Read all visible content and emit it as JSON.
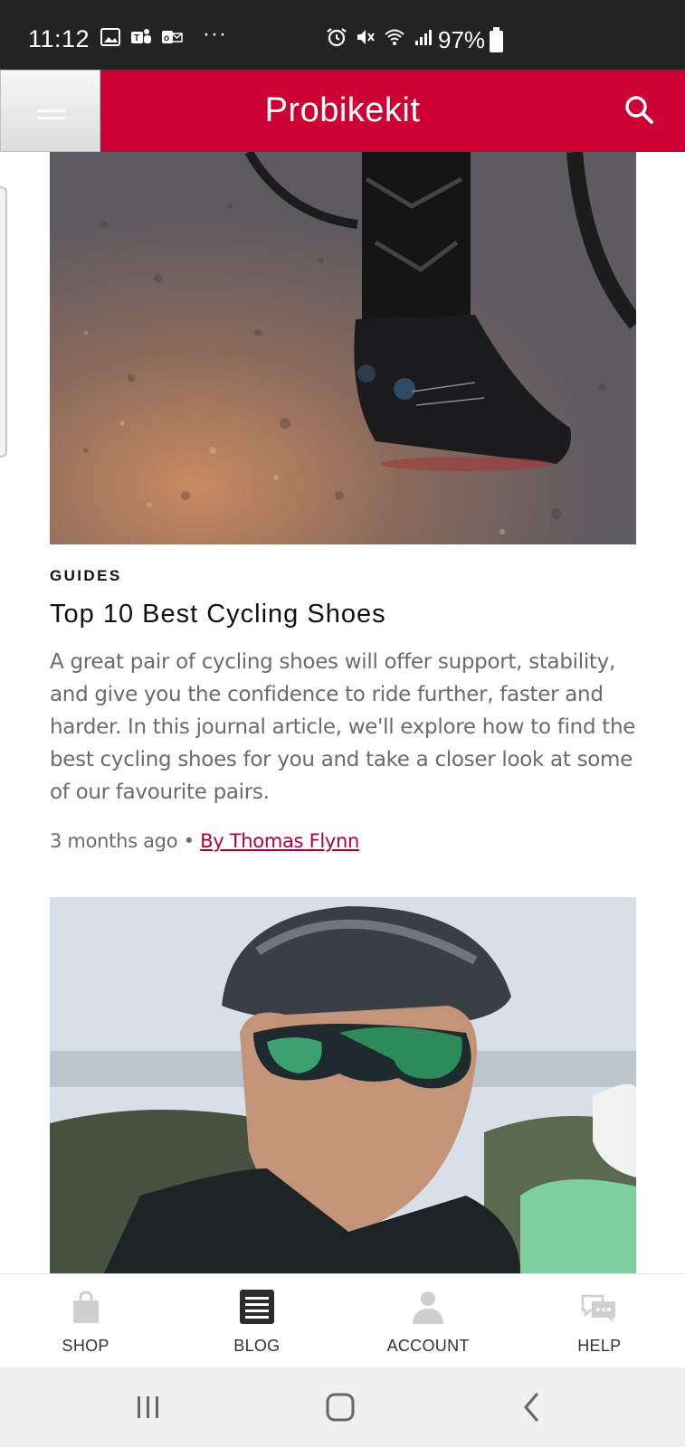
{
  "status_bar": {
    "time": "11:12",
    "more": "···",
    "battery": "97%",
    "icons": [
      "gallery-icon",
      "teams-icon",
      "outlook-icon",
      "alarm-icon",
      "mute-icon",
      "wifi-icon",
      "signal-icon",
      "battery-icon"
    ]
  },
  "header": {
    "brand": "Probikekit",
    "menu_icon": "hamburger-menu-icon",
    "search_icon": "search-icon",
    "accent": "#cc0033"
  },
  "article": {
    "label": "GUIDES",
    "title": "Top 10 Best Cycling Shoes",
    "excerpt": "A great pair of cycling shoes will offer support, stability, and give you the confidence to ride further, faster and harder. In this journal article, we'll explore how to find the best cycling shoes for you and take a closer look at some of our favourite pairs.",
    "age": "3 months ago",
    "separator": "•",
    "author": "By Thomas Flynn"
  },
  "bottom_nav": {
    "items": [
      {
        "label": "SHOP",
        "icon": "shopping-bag-icon"
      },
      {
        "label": "BLOG",
        "icon": "blog-list-icon"
      },
      {
        "label": "ACCOUNT",
        "icon": "account-person-icon"
      },
      {
        "label": "HELP",
        "icon": "chat-bubbles-icon"
      }
    ]
  },
  "system_nav": {
    "icons": [
      "recents-icon",
      "home-icon",
      "back-icon"
    ]
  }
}
